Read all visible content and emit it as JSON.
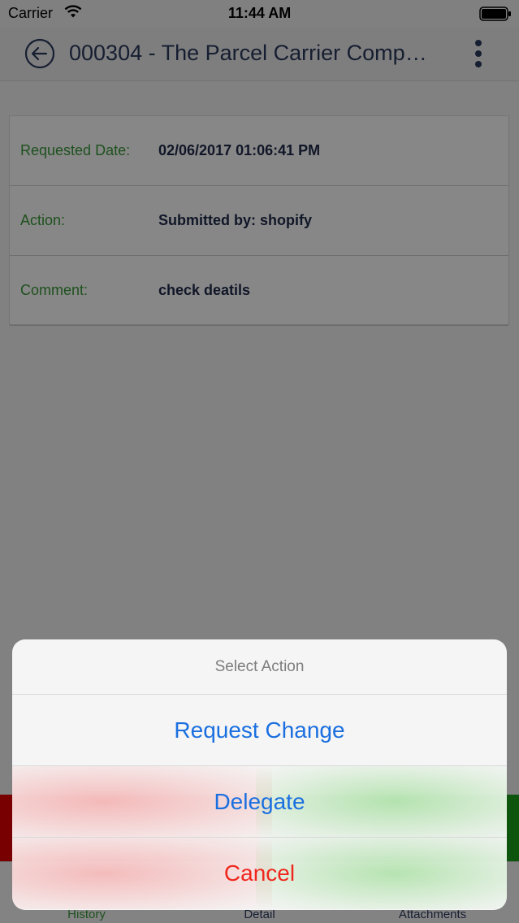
{
  "status_bar": {
    "carrier": "Carrier",
    "time": "11:44 AM"
  },
  "nav": {
    "title": "000304 - The Parcel Carrier Comp…",
    "icons": [
      "back-arrow-icon",
      "more-vertical-icon"
    ]
  },
  "details": [
    {
      "label": "Requested Date:",
      "value": "02/06/2017 01:06:41 PM"
    },
    {
      "label": "Action:",
      "value": "Submitted by: shopify"
    },
    {
      "label": "Comment:",
      "value": "check deatils"
    }
  ],
  "tabs": [
    {
      "label": "History",
      "active": true
    },
    {
      "label": "Detail",
      "active": false
    },
    {
      "label": "Attachments",
      "active": false
    }
  ],
  "action_sheet": {
    "title": "Select Action",
    "options": [
      {
        "label": "Request Change"
      },
      {
        "label": "Delegate"
      }
    ],
    "cancel_label": "Cancel"
  },
  "colors": {
    "label_green": "#3a9a3a",
    "value_navy": "#1f2a4a",
    "action_blue": "#1a6fe0",
    "destructive_red": "#f0271d",
    "reject_strip": "#e40000",
    "approve_strip": "#1aa01a"
  }
}
